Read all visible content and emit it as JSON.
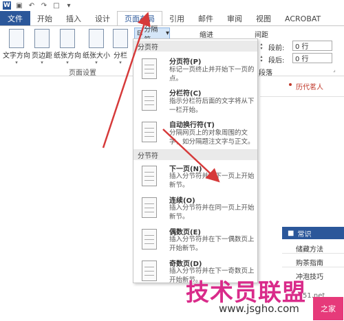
{
  "tabs": [
    "文件",
    "开始",
    "插入",
    "设计",
    "页面布局",
    "引用",
    "邮件",
    "审阅",
    "视图",
    "ACROBAT"
  ],
  "ribbon": {
    "buttons": [
      "文字方向",
      "页边距",
      "纸张方向",
      "纸张大小",
      "分栏"
    ],
    "group_label": "页面设置",
    "breaks_button": "分隔符",
    "indent_label": "缩进",
    "spacing_label": "间距",
    "before_label": "段前:",
    "before_value": "0 行",
    "after_label": "段后:",
    "after_value": "0 行",
    "paragraph_label": "段落"
  },
  "menu": {
    "section1": "分页符",
    "section2": "分节符",
    "items": [
      {
        "title": "分页符(P)",
        "desc": "标记一页终止并开始下一页的点。"
      },
      {
        "title": "分栏符(C)",
        "desc": "指示分栏符后面的文字将从下一栏开始。"
      },
      {
        "title": "自动换行符(T)",
        "desc": "分隔网页上的对象周围的文字，如分隔题注文字与正文。"
      },
      {
        "title": "下一页(N)",
        "desc": "插入分节符并在下一页上开始新节。"
      },
      {
        "title": "连续(O)",
        "desc": "插入分节符并在同一页上开始新节。"
      },
      {
        "title": "偶数页(E)",
        "desc": "插入分节符并在下一偶数页上开始新节。"
      },
      {
        "title": "奇数页(D)",
        "desc": "插入分节符并在下一奇数页上开始新节。"
      }
    ]
  },
  "sidebar": {
    "top_item": "历代茗人",
    "header": "常识",
    "items": [
      "储藏方法",
      "购茶指南",
      "冲泡技巧"
    ]
  },
  "watermark": {
    "text": "技术员联盟",
    "url": "www.jsgho.com",
    "badge": "之家",
    "small": "51.net"
  }
}
